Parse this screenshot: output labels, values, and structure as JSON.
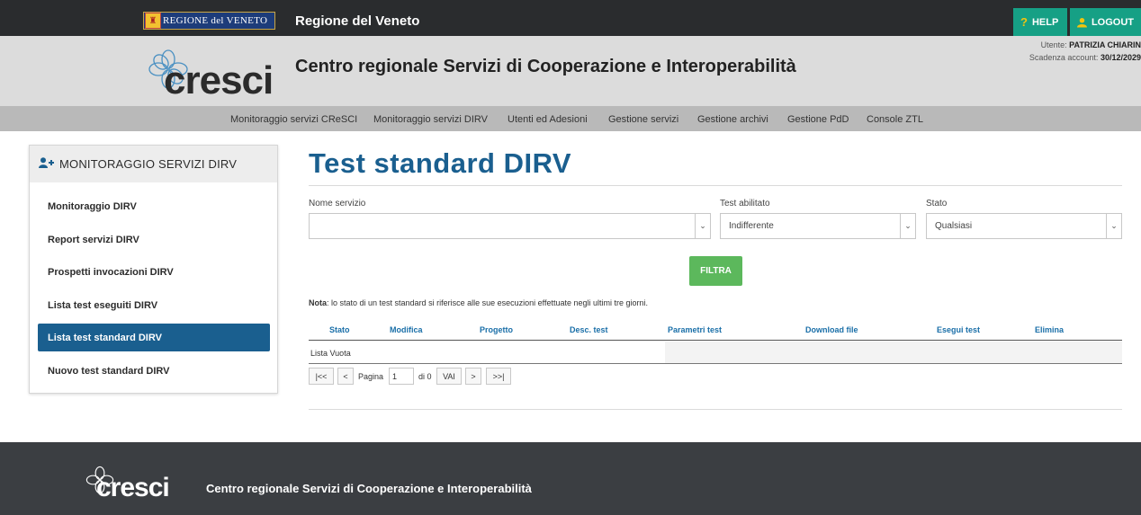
{
  "topbar": {
    "region_logo_text": "REGIONE del VENETO",
    "title": "Regione del Veneto",
    "help_label": "HELP",
    "logout_label": "LOGOUT"
  },
  "header": {
    "logo_text": "cresci",
    "title": "Centro regionale Servizi di Cooperazione e Interoperabilità",
    "user_label": "Utente:",
    "user_name": "PATRIZIA CHIARIN",
    "expiry_label": "Scadenza account:",
    "expiry_date": "30/12/2029"
  },
  "nav": {
    "items": [
      "Monitoraggio servizi CReSCI",
      "Monitoraggio servizi DIRV",
      "Utenti ed Adesioni",
      "Gestione servizi",
      "Gestione archivi",
      "Gestione PdD",
      "Console ZTL"
    ]
  },
  "sidebar": {
    "title": "MONITORAGGIO SERVIZI DIRV",
    "items": [
      "Monitoraggio DIRV",
      "Report servizi DIRV",
      "Prospetti invocazioni DIRV",
      "Lista test eseguiti DIRV",
      "Lista test standard DIRV",
      "Nuovo test standard DIRV"
    ],
    "active_index": 4
  },
  "main": {
    "title": "Test standard DIRV",
    "filters": {
      "service_label": "Nome servizio",
      "service_value": "",
      "enabled_label": "Test abilitato",
      "enabled_value": "Indifferente",
      "state_label": "Stato",
      "state_value": "Qualsiasi"
    },
    "filter_button": "FILTRA",
    "note_bold": "Nota",
    "note_text": ": lo stato di un test standard si riferisce alle sue esecuzioni effettuate negli ultimi tre giorni.",
    "table": {
      "columns": [
        "Stato",
        "Modifica",
        "Progetto",
        "Desc. test",
        "Parametri test",
        "Download file",
        "Esegui test",
        "Elimina"
      ],
      "empty_text": "Lista Vuota"
    },
    "pager": {
      "first": "|<<",
      "prev": "<",
      "page_label": "Pagina",
      "page_value": "1",
      "of_label": "di 0",
      "go": "VAI",
      "next": ">",
      "last": ">>|"
    }
  },
  "footer": {
    "logo_text": "cresci",
    "title": "Centro regionale Servizi di Cooperazione e Interoperabilità"
  },
  "colors": {
    "accent": "#1a5f8f",
    "teal": "#16a085",
    "green": "#5cb85c",
    "dark": "#2a2c2e"
  }
}
